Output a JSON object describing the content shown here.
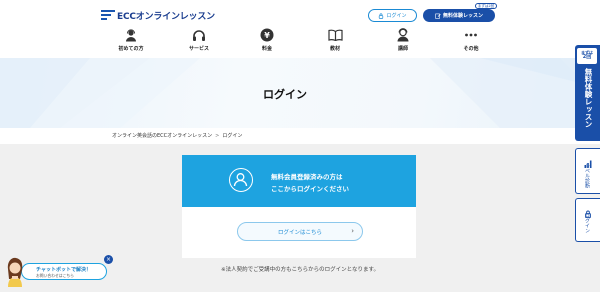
{
  "header": {
    "logo_text": "ECCオンラインレッスン",
    "login_button": "ログイン",
    "trial_button": "無料体験レッスン",
    "trial_badge": "まずは2回"
  },
  "nav": {
    "items": [
      {
        "label": "初めての方",
        "icon": "headset-person-icon"
      },
      {
        "label": "サービス",
        "icon": "headphones-icon"
      },
      {
        "label": "料金",
        "icon": "yen-icon"
      },
      {
        "label": "教材",
        "icon": "book-icon"
      },
      {
        "label": "講師",
        "icon": "teacher-icon"
      },
      {
        "label": "その他",
        "icon": "more-dots-icon"
      }
    ]
  },
  "page": {
    "title": "ログイン",
    "breadcrumb": [
      "オンライン英会話のECCオンラインレッスン",
      "ログイン"
    ]
  },
  "card": {
    "line1": "無料会員登録済みの方は",
    "line2": "ここからログインください",
    "button": "ログインはこちら"
  },
  "note": "※法人契約でご受講中の方もこちらからのログインとなります。",
  "side": {
    "trial_badge_1": "まずは",
    "trial_badge_2": "2回",
    "trial_label": "無料体験レッスン",
    "lesson_label": "レベル診断",
    "login_label": "ログイン"
  },
  "chat": {
    "title": "チャットボットで解決！",
    "subtitle": "お問い合わせはこちら",
    "close": "×"
  },
  "colors": {
    "brand_blue": "#1a4fa8",
    "accent_blue": "#1ea3e0"
  }
}
